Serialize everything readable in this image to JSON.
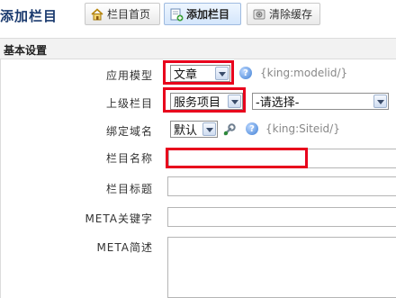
{
  "header": {
    "title": "添加栏目",
    "buttons": [
      {
        "label": "栏目首页",
        "icon": "home-icon"
      },
      {
        "label": "添加栏目",
        "icon": "add-page-icon"
      },
      {
        "label": "清除缓存",
        "icon": "clear-cache-icon"
      }
    ]
  },
  "section": {
    "title": "基本设置"
  },
  "form": {
    "model": {
      "label": "应用模型",
      "value": "文章",
      "hint": "{king:modelid/}"
    },
    "parent": {
      "label": "上级栏目",
      "value": "服务项目",
      "value2": "-请选择-"
    },
    "domain": {
      "label": "绑定域名",
      "value": "默认",
      "hint": "{king:Siteid/}"
    },
    "name": {
      "label": "栏目名称",
      "value": ""
    },
    "column_title": {
      "label": "栏目标题",
      "value": ""
    },
    "meta_keywords": {
      "label": "META关键字",
      "value": ""
    },
    "meta_desc": {
      "label": "META简述",
      "value": ""
    }
  },
  "colors": {
    "highlight": "#e8001c",
    "title": "#1a3a6e"
  }
}
